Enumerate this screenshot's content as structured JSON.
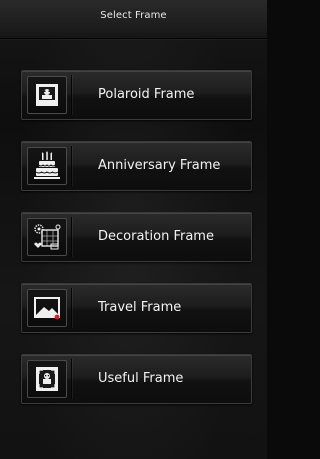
{
  "header": {
    "title": "Select Frame"
  },
  "menu": {
    "items": [
      {
        "label": "Polaroid Frame",
        "icon": "polaroid-frame-icon"
      },
      {
        "label": "Anniversary Frame",
        "icon": "birthday-cake-icon"
      },
      {
        "label": "Decoration Frame",
        "icon": "decoration-frame-icon"
      },
      {
        "label": "Travel Frame",
        "icon": "travel-photo-icon"
      },
      {
        "label": "Useful Frame",
        "icon": "useful-frame-icon"
      }
    ]
  },
  "colors": {
    "background": "#0e0e0e",
    "text": "#f2f2f2",
    "accent_red": "#e02020"
  }
}
